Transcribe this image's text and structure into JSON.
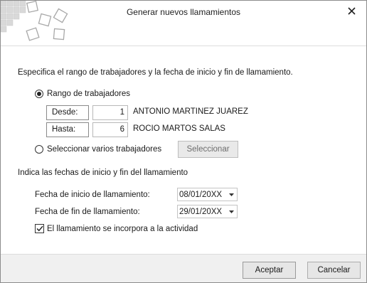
{
  "window": {
    "title": "Generar nuevos llamamientos",
    "close_icon": "close-icon"
  },
  "intro_text": "Especifica el rango de trabajadores y la fecha de inicio y fin de llamamiento.",
  "range_option": {
    "label": "Rango de trabajadores",
    "selected": true,
    "from": {
      "label": "Desde:",
      "value": "1",
      "name": "ANTONIO MARTINEZ JUAREZ"
    },
    "to": {
      "label": "Hasta:",
      "value": "6",
      "name": "ROCIO MARTOS SALAS"
    }
  },
  "multi_option": {
    "label": "Seleccionar varios trabajadores",
    "selected": false,
    "button_label": "Seleccionar"
  },
  "dates_section": {
    "heading": "Indica las fechas de inicio y fin del llamamiento",
    "start": {
      "label": "Fecha de inicio de llamamiento:",
      "value": "08/01/20XX"
    },
    "end": {
      "label": "Fecha de fin de llamamiento:",
      "value": "29/01/20XX"
    }
  },
  "activity_checkbox": {
    "label": "El llamamiento se incorpora a la actividad",
    "checked": true
  },
  "footer": {
    "accept_label": "Aceptar",
    "cancel_label": "Cancelar"
  }
}
